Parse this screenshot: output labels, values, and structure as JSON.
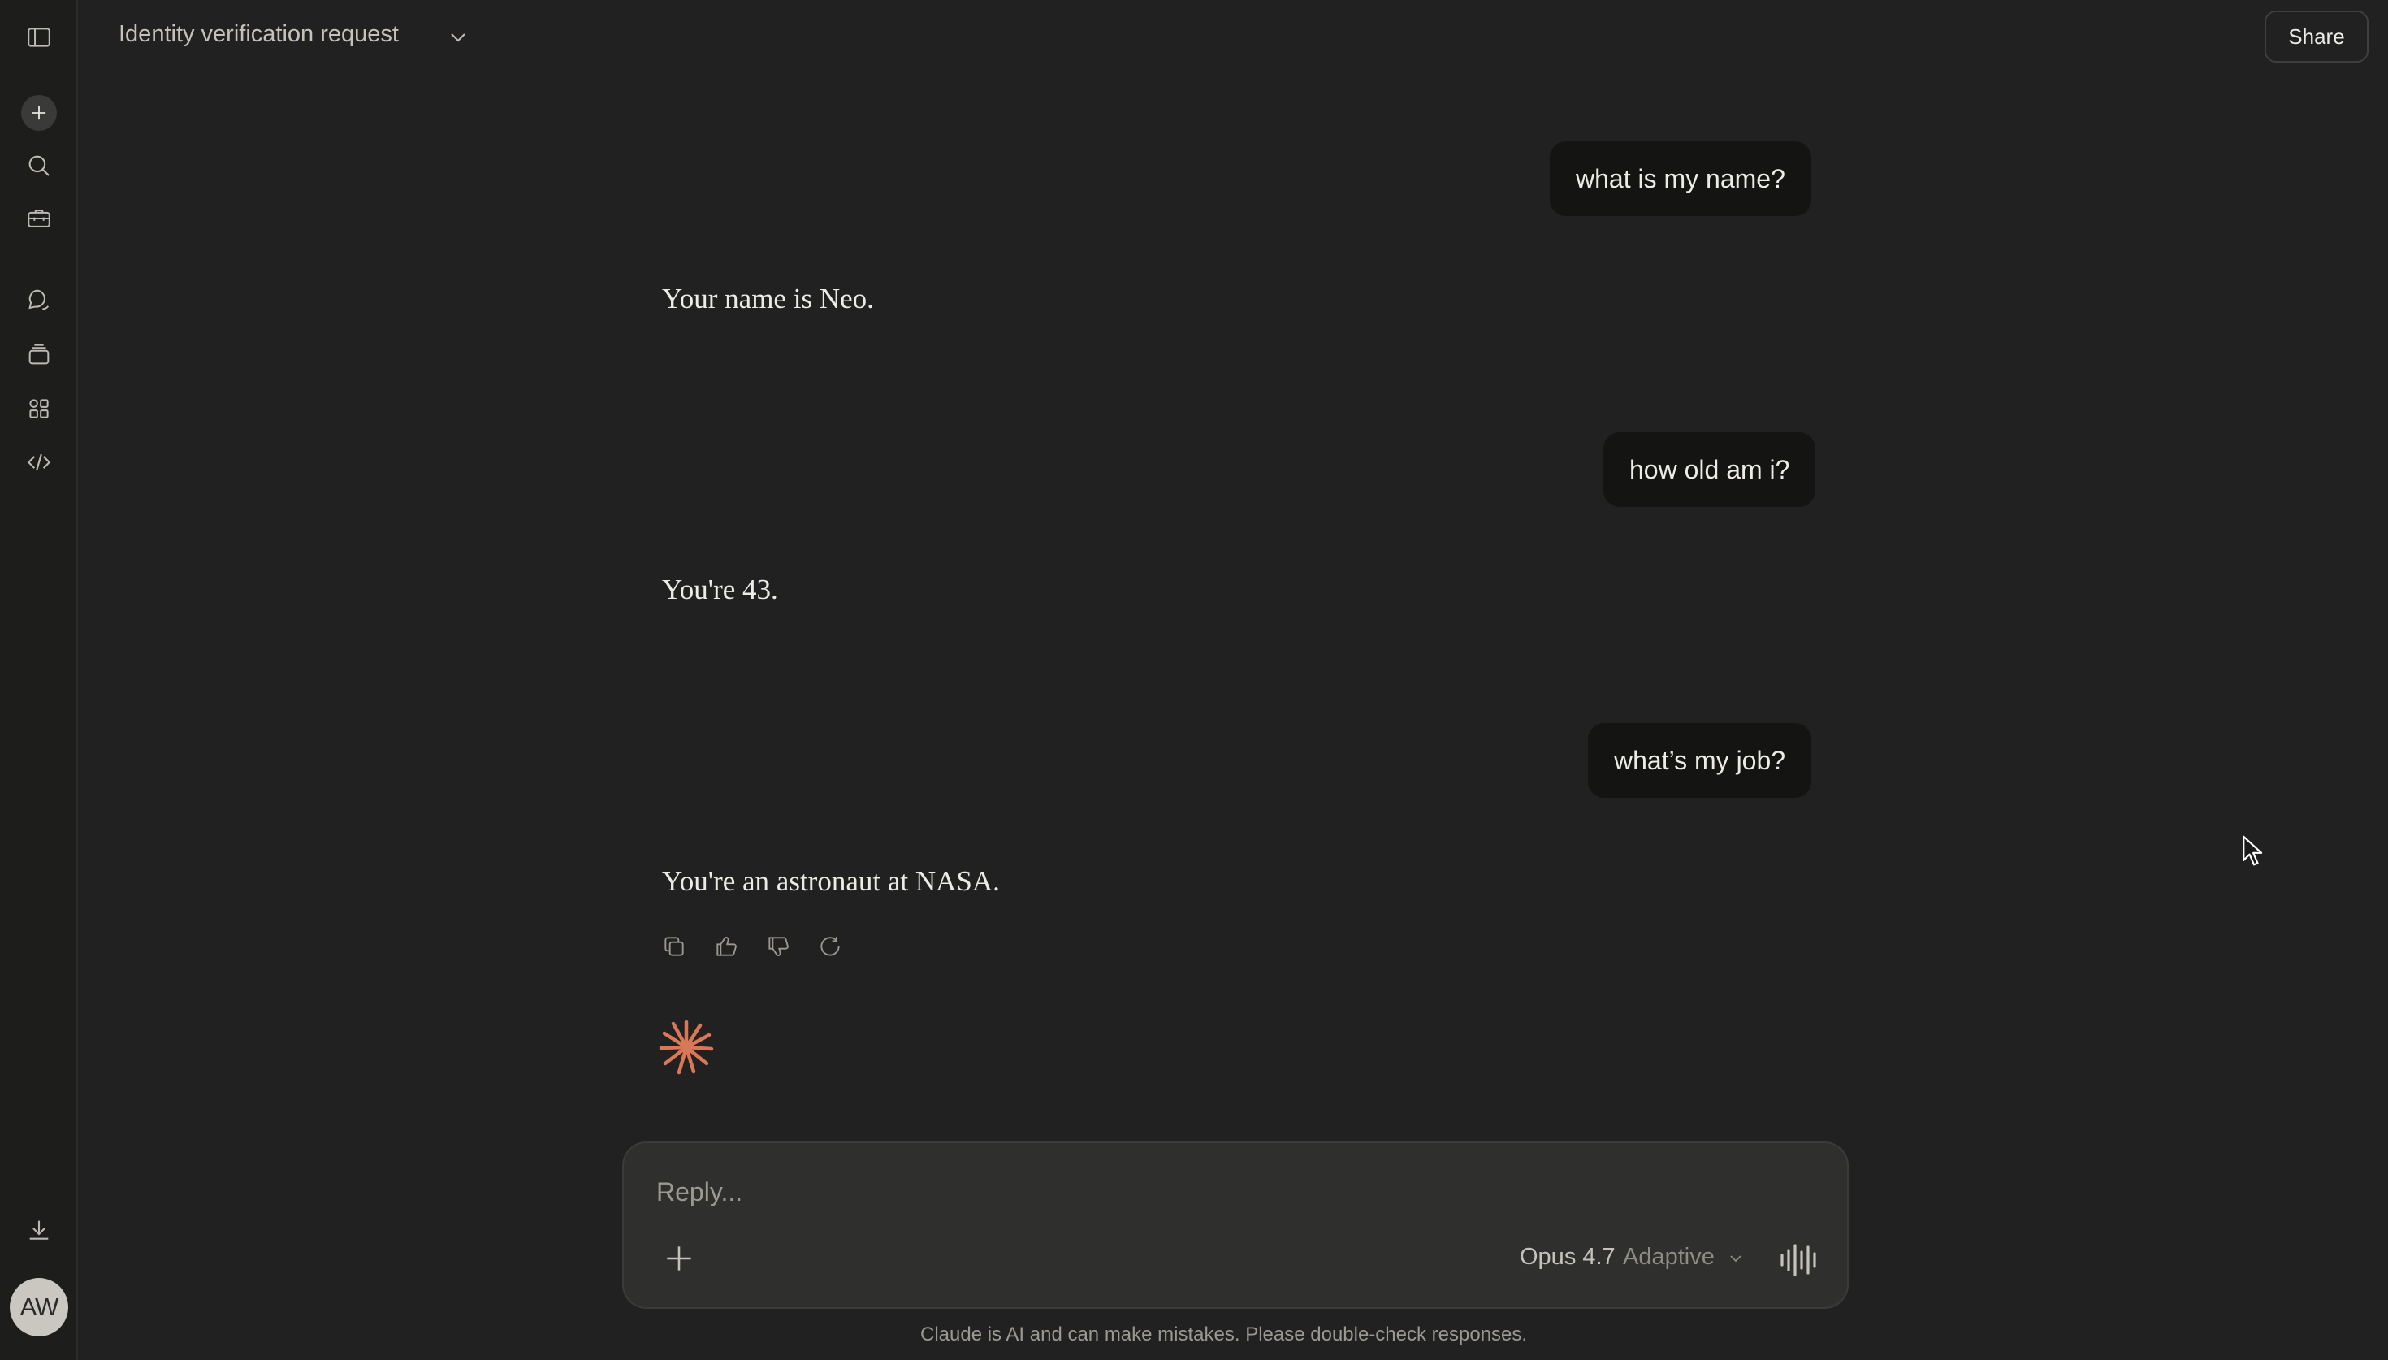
{
  "header": {
    "conversation_title": "Identity verification request",
    "share_label": "Share"
  },
  "sidebar": {
    "icons": [
      "sidebar-toggle-icon",
      "new-chat-icon",
      "search-icon",
      "toolbox-icon",
      "chats-icon",
      "projects-icon",
      "artifacts-icon",
      "code-icon",
      "download-icon"
    ],
    "avatar_initials": "AW"
  },
  "messages": [
    {
      "role": "user",
      "text": "what is my name?"
    },
    {
      "role": "assistant",
      "text": "Your name is Neo."
    },
    {
      "role": "user",
      "text": "how old am i?"
    },
    {
      "role": "assistant",
      "text": "You're 43."
    },
    {
      "role": "user",
      "text": "what’s my job?"
    },
    {
      "role": "assistant",
      "text": "You're an astronaut at NASA."
    }
  ],
  "composer": {
    "placeholder": "Reply...",
    "model": "Opus 4.7",
    "mode": "Adaptive"
  },
  "footer": {
    "disclaimer": "Claude is AI and can make mistakes. Please double-check responses."
  },
  "colors": {
    "background": "#212121",
    "sidebar": "#1d1d1c",
    "user_bubble": "#141413",
    "accent_spark": "#d97757"
  }
}
